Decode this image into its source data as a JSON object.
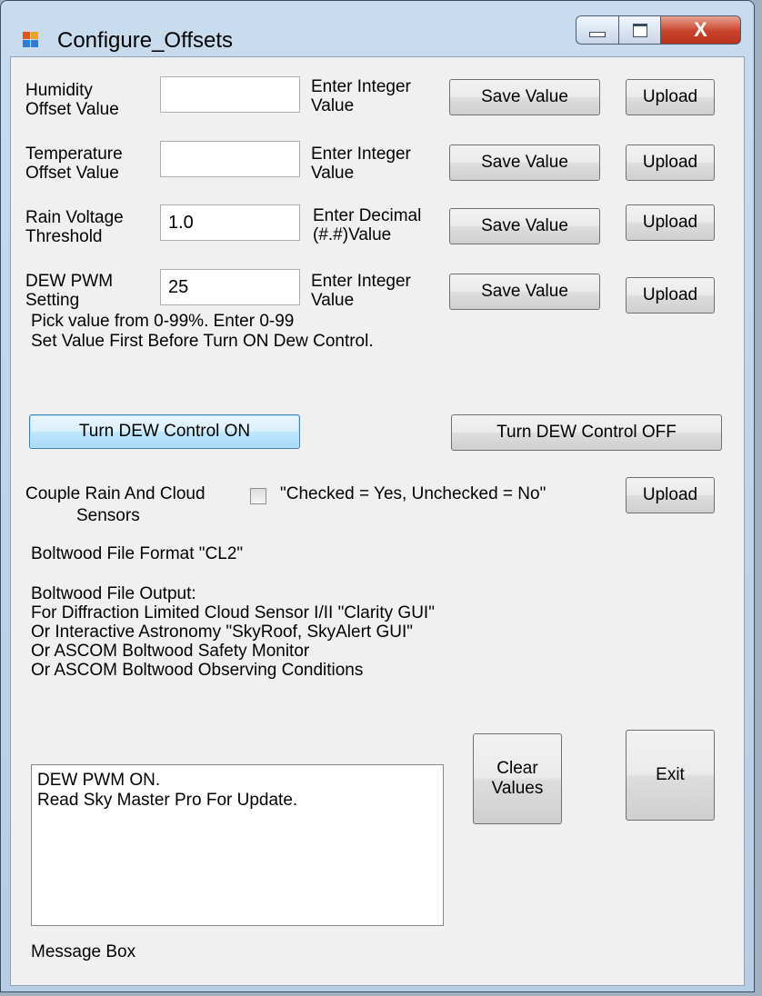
{
  "window": {
    "title": "Configure_Offsets",
    "icon": "form-app-icon",
    "controls": {
      "minimize": "minimize-icon",
      "maximize": "maximize-icon",
      "close": "close-icon"
    }
  },
  "rows": [
    {
      "label": "Humidity\nOffset Value",
      "value": "",
      "hint": "Enter Integer\nValue",
      "save": "Save Value",
      "upload": "Upload"
    },
    {
      "label": "Temperature\nOffset Value",
      "value": "",
      "hint": "Enter Integer\nValue",
      "save": "Save Value",
      "upload": "Upload"
    },
    {
      "label": "Rain Voltage\nThreshold",
      "value": "1.0",
      "hint": "Enter Decimal\n(#.#)Value",
      "save": "Save Value",
      "upload": "Upload"
    },
    {
      "label": "DEW PWM\nSetting",
      "value": "25",
      "hint": "Enter Integer\nValue",
      "save": "Save Value",
      "upload": "Upload"
    }
  ],
  "dew": {
    "note1": "Pick value from 0-99%. Enter 0-99",
    "note2": "Set Value First Before Turn ON Dew Control.",
    "on_label": "Turn DEW Control ON",
    "off_label": "Turn DEW Control OFF"
  },
  "couple": {
    "label1": "Couple Rain And Cloud",
    "label2": "Sensors",
    "checked": false,
    "hint": "\"Checked = Yes,  Unchecked = No\"",
    "upload": "Upload"
  },
  "boltwood": {
    "format": "Boltwood File Format \"CL2\"",
    "output_lines": "Boltwood File Output:\nFor Diffraction Limited Cloud Sensor I/II \"Clarity GUI\"\nOr Interactive Astronomy \"SkyRoof, SkyAlert GUI\"\nOr ASCOM Boltwood Safety Monitor\nOr ASCOM Boltwood Observing Conditions"
  },
  "message": {
    "text": "DEW PWM ON.\nRead Sky Master Pro For Update.",
    "caption": "Message Box"
  },
  "buttons": {
    "clear": "Clear\nValues",
    "exit": "Exit"
  }
}
